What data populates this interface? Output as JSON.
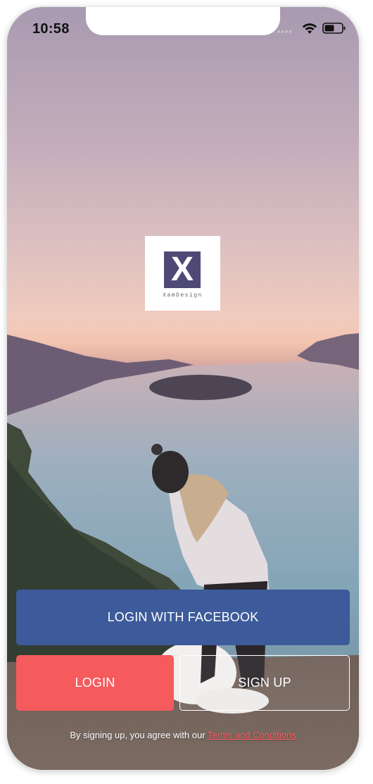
{
  "status_bar": {
    "time": "10:58"
  },
  "logo": {
    "mark": "X",
    "text": "XamDesign"
  },
  "buttons": {
    "facebook_label": "LOGIN WITH FACEBOOK",
    "login_label": "LOGIN",
    "signup_label": "SIGN UP"
  },
  "terms": {
    "prefix": "By signing up, you agree with our ",
    "link": "Terms and Conditions"
  },
  "colors": {
    "facebook": "#3d5a9a",
    "login": "#f55a5d",
    "link": "#ff5e62",
    "logo_mark": "#4f4a75"
  },
  "icons": [
    "signal-dots-icon",
    "wifi-icon",
    "battery-icon"
  ]
}
